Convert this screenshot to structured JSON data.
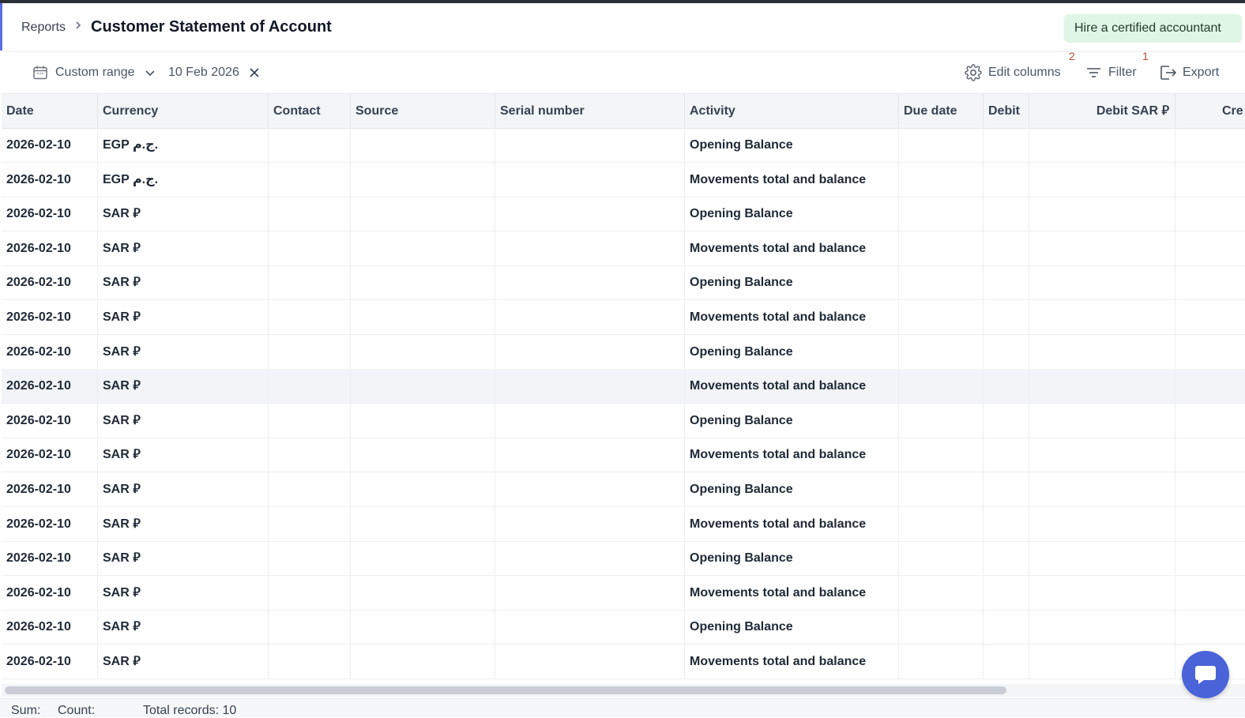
{
  "header": {
    "breadcrumb": "Reports",
    "title": "Customer Statement of Account",
    "hire_button": "Hire a certified accountant"
  },
  "toolbar": {
    "range_label": "Custom range",
    "date_value": "10 Feb 2026",
    "edit_columns": "Edit columns",
    "edit_columns_badge": "2",
    "filter": "Filter",
    "filter_badge": "1",
    "export": "Export"
  },
  "table": {
    "columns": [
      "Date",
      "Currency",
      "Contact",
      "Source",
      "Serial number",
      "Activity",
      "Due date",
      "Debit",
      "Debit SAR ⃁",
      "Cre"
    ],
    "rows": [
      {
        "date": "2026-02-10",
        "currency": "EGP ج.م.",
        "activity": "Opening Balance"
      },
      {
        "date": "2026-02-10",
        "currency": "EGP ج.م.",
        "activity": "Movements total and balance"
      },
      {
        "date": "2026-02-10",
        "currency": "SAR ⃁",
        "activity": "Opening Balance"
      },
      {
        "date": "2026-02-10",
        "currency": "SAR ⃁",
        "activity": "Movements total and balance"
      },
      {
        "date": "2026-02-10",
        "currency": "SAR ⃁",
        "activity": "Opening Balance"
      },
      {
        "date": "2026-02-10",
        "currency": "SAR ⃁",
        "activity": "Movements total and balance"
      },
      {
        "date": "2026-02-10",
        "currency": "SAR ⃁",
        "activity": "Opening Balance"
      },
      {
        "date": "2026-02-10",
        "currency": "SAR ⃁",
        "activity": "Movements total and balance"
      },
      {
        "date": "2026-02-10",
        "currency": "SAR ⃁",
        "activity": "Opening Balance"
      },
      {
        "date": "2026-02-10",
        "currency": "SAR ⃁",
        "activity": "Movements total and balance"
      },
      {
        "date": "2026-02-10",
        "currency": "SAR ⃁",
        "activity": "Opening Balance"
      },
      {
        "date": "2026-02-10",
        "currency": "SAR ⃁",
        "activity": "Movements total and balance"
      },
      {
        "date": "2026-02-10",
        "currency": "SAR ⃁",
        "activity": "Opening Balance"
      },
      {
        "date": "2026-02-10",
        "currency": "SAR ⃁",
        "activity": "Movements total and balance"
      },
      {
        "date": "2026-02-10",
        "currency": "SAR ⃁",
        "activity": "Opening Balance"
      },
      {
        "date": "2026-02-10",
        "currency": "SAR ⃁",
        "activity": "Movements total and balance"
      }
    ]
  },
  "footer": {
    "sum_label": "Sum:",
    "count_label": "Count:",
    "total_records": "Total records: 10"
  },
  "colors": {
    "accent": "#5b6ee1",
    "hire_bg": "#dff5e6",
    "chat_bg": "#4a63d8",
    "badge": "#b4533a"
  },
  "icons": [
    "calendar-icon",
    "chevron-down-icon",
    "close-icon",
    "gear-icon",
    "filter-icon",
    "export-icon",
    "chat-icon"
  ]
}
